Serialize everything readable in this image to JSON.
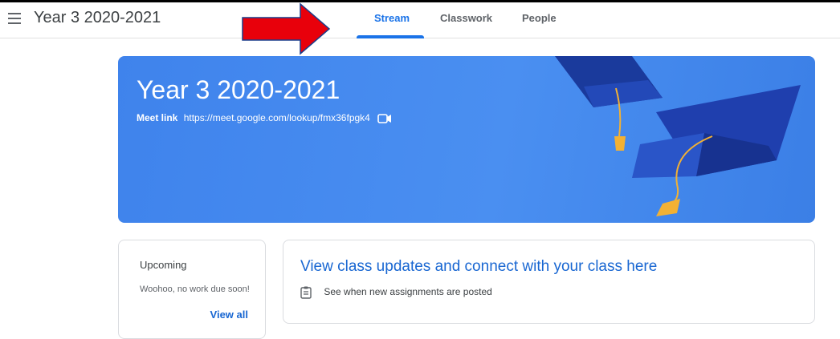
{
  "header": {
    "class_title": "Year 3 2020-2021",
    "tabs": [
      {
        "label": "Stream",
        "active": true
      },
      {
        "label": "Classwork",
        "active": false
      },
      {
        "label": "People",
        "active": false
      }
    ]
  },
  "banner": {
    "title": "Year 3 2020-2021",
    "meet_label": "Meet link",
    "meet_url": "https://meet.google.com/lookup/fmx36fpgk4"
  },
  "upcoming": {
    "title": "Upcoming",
    "subtitle": "Woohoo, no work due soon!",
    "view_all": "View all"
  },
  "updates": {
    "title": "View class updates and connect with your class here",
    "item": "See when new assignments are posted"
  },
  "icons": {
    "menu": "hamburger-menu-icon",
    "arrow": "red-arrow-annotation",
    "video": "video-camera-icon",
    "assignment": "assignment-clipboard-icon"
  },
  "colors": {
    "accent": "#1a73e8",
    "banner": "#4285f4",
    "annotation_arrow": "#e8000b"
  }
}
